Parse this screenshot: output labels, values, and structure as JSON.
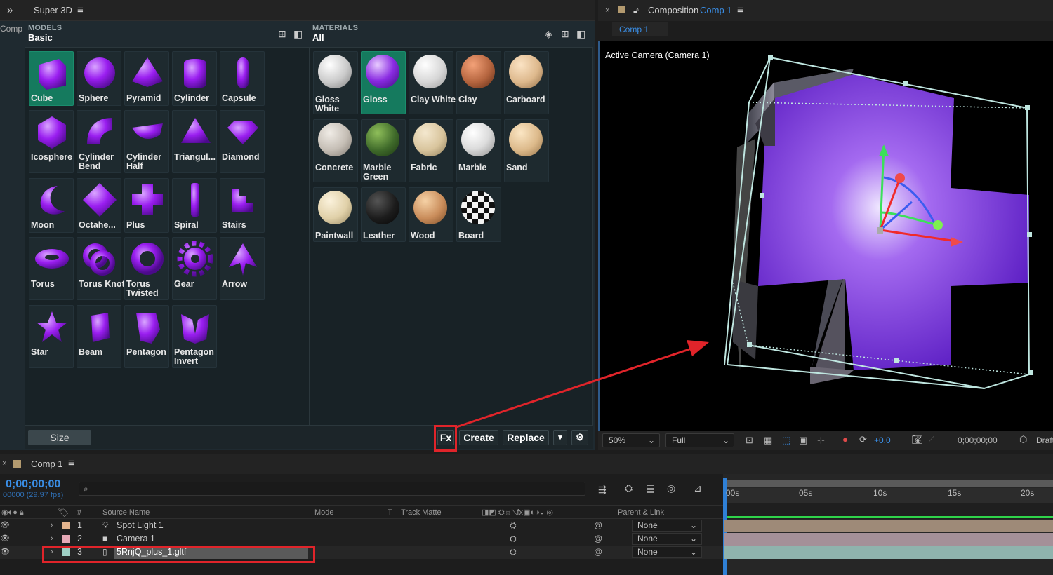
{
  "panel": {
    "title": "Super 3D",
    "comp_cut": "Comp"
  },
  "models": {
    "section": "MODELS",
    "category": "Basic",
    "items": [
      "Cube",
      "Sphere",
      "Pyramid",
      "Cylinder",
      "Capsule",
      "Icosphere",
      "Cylinder Bend",
      "Cylinder Half",
      "Triangul...",
      "Diamond",
      "Moon",
      "Octahe...",
      "Plus",
      "Spiral",
      "Stairs",
      "Torus",
      "Torus Knot",
      "Torus Twisted",
      "Gear",
      "Arrow",
      "Star",
      "Beam",
      "Pentagon",
      "Pentagon Invert"
    ],
    "selected": "Cube"
  },
  "materials": {
    "section": "MATERIALS",
    "category": "All",
    "items": [
      "Gloss White",
      "Gloss",
      "Clay White",
      "Clay",
      "Carboard",
      "Concrete",
      "Marble Green",
      "Fabric",
      "Marble",
      "Sand",
      "Paintwall",
      "Leather",
      "Wood",
      "Board"
    ],
    "selected": "Gloss"
  },
  "bottom_bar": {
    "size_label": "Size",
    "fx_label": "Fx",
    "create_label": "Create",
    "replace_label": "Replace",
    "dropdown_glyph": "▾"
  },
  "composition": {
    "prefix": "Composition",
    "name": "Comp 1",
    "tab": "Comp 1",
    "camera_label": "Active Camera (Camera 1)",
    "zoom": "50%",
    "resolution": "Full",
    "exposure": "+0.0",
    "timecode": "0;00;00;00",
    "draft": "Draft"
  },
  "timeline": {
    "comp_tab": "Comp 1",
    "timecode": "0;00;00;00",
    "frames": "00000 (29.97 fps)",
    "search_placeholder": "",
    "columns": {
      "num": "#",
      "source": "Source Name",
      "mode": "Mode",
      "t": "T",
      "track_matte": "Track Matte",
      "parent": "Parent & Link"
    },
    "ruler": [
      "00s",
      "05s",
      "10s",
      "15s",
      "20s"
    ],
    "layers": [
      {
        "num": "1",
        "name": "Spot Light 1",
        "parent": "None",
        "color": "#e3b48e"
      },
      {
        "num": "2",
        "name": "Camera 1",
        "parent": "None",
        "color": "#e6a9b6"
      },
      {
        "num": "3",
        "name": "5RnjQ_plus_1.gltf",
        "parent": "None",
        "color": "#9fd0c4"
      }
    ]
  },
  "colors": {
    "accent_selected": "#157a5e",
    "highlight_red": "#e0242a",
    "model_purple": "#8a2be2",
    "timecode_blue": "#3a8ee6"
  }
}
